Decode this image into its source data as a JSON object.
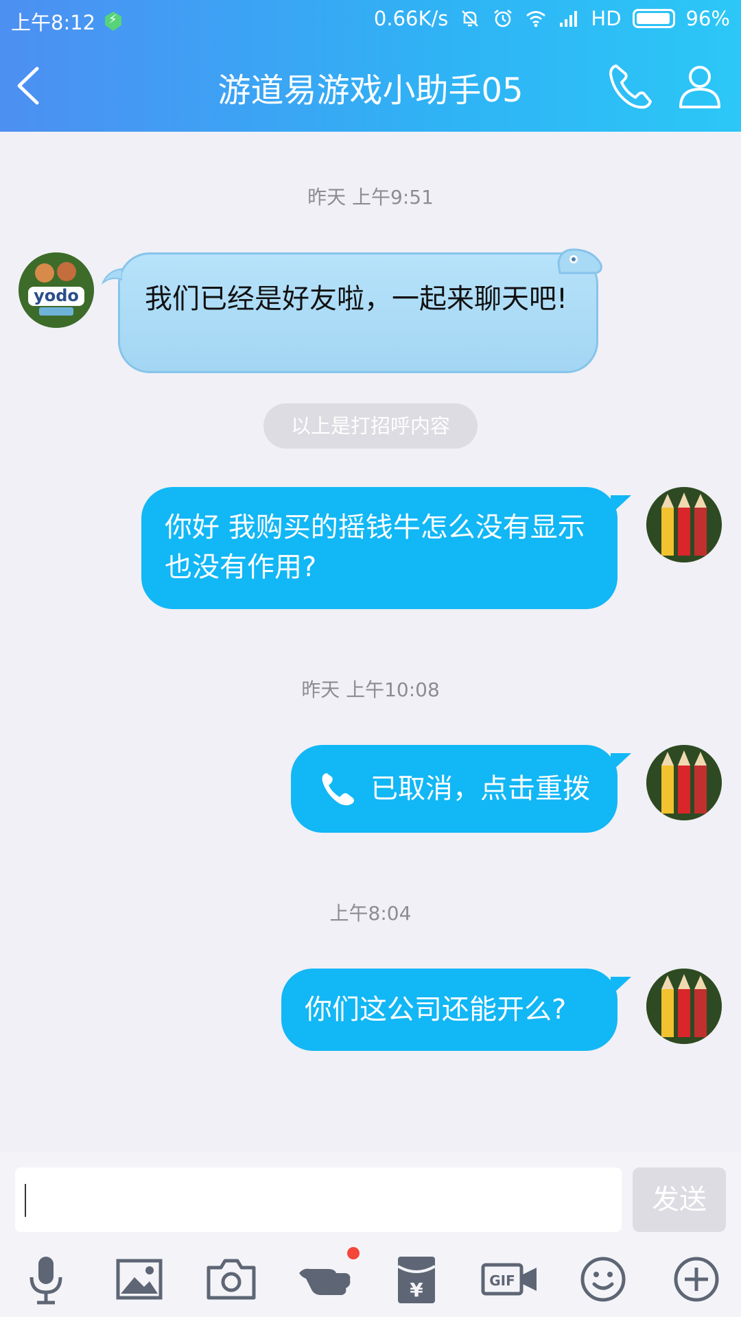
{
  "status_bar": {
    "time": "上午8:12",
    "net_speed": "0.66K/s",
    "network": "HD",
    "battery": "96%"
  },
  "header": {
    "title": "游道易游戏小助手05"
  },
  "chat": {
    "timestamps": [
      "昨天 上午9:51",
      "昨天 上午10:08",
      "上午8:04"
    ],
    "greeting_message": "我们已经是好友啦，一起来聊天吧!",
    "greeting_divider": "以上是打招呼内容",
    "messages": [
      "你好 我购买的摇钱牛怎么没有显示也没有作用?",
      "已取消，点击重拨",
      "你们这公司还能开么?"
    ]
  },
  "input": {
    "value": "",
    "send_label": "发送"
  },
  "toolbar": {
    "items": [
      "mic-icon",
      "image-icon",
      "camera-icon",
      "poke-icon",
      "red-packet-icon",
      "gif-icon",
      "emoji-icon",
      "plus-icon"
    ]
  },
  "colors": {
    "header_start": "#4d8ff2",
    "header_end": "#2cc7f7",
    "outgoing_bubble": "#12b7f5",
    "incoming_bubble": "#a3d6f3",
    "background": "#f0f0f6",
    "badge_red": "#f5463a"
  }
}
